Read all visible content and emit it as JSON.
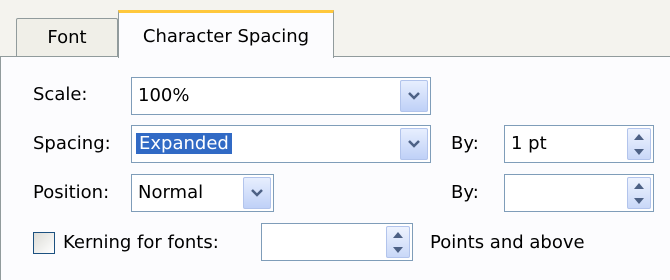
{
  "tabs": [
    {
      "label": "Font"
    },
    {
      "label": "Character Spacing"
    }
  ],
  "scale": {
    "label": "Scale:",
    "value": "100%"
  },
  "spacing": {
    "label": "Spacing:",
    "value": "Expanded",
    "by_label": "By:",
    "by_value": "1 pt"
  },
  "position": {
    "label": "Position:",
    "value": "Normal",
    "by_label": "By:",
    "by_value": ""
  },
  "kerning": {
    "label": "Kerning for fonts:",
    "checked": false,
    "value": "",
    "suffix": "Points and above"
  },
  "colors": {
    "accent_tab": "#ffc83c",
    "selection": "#316ac5"
  }
}
